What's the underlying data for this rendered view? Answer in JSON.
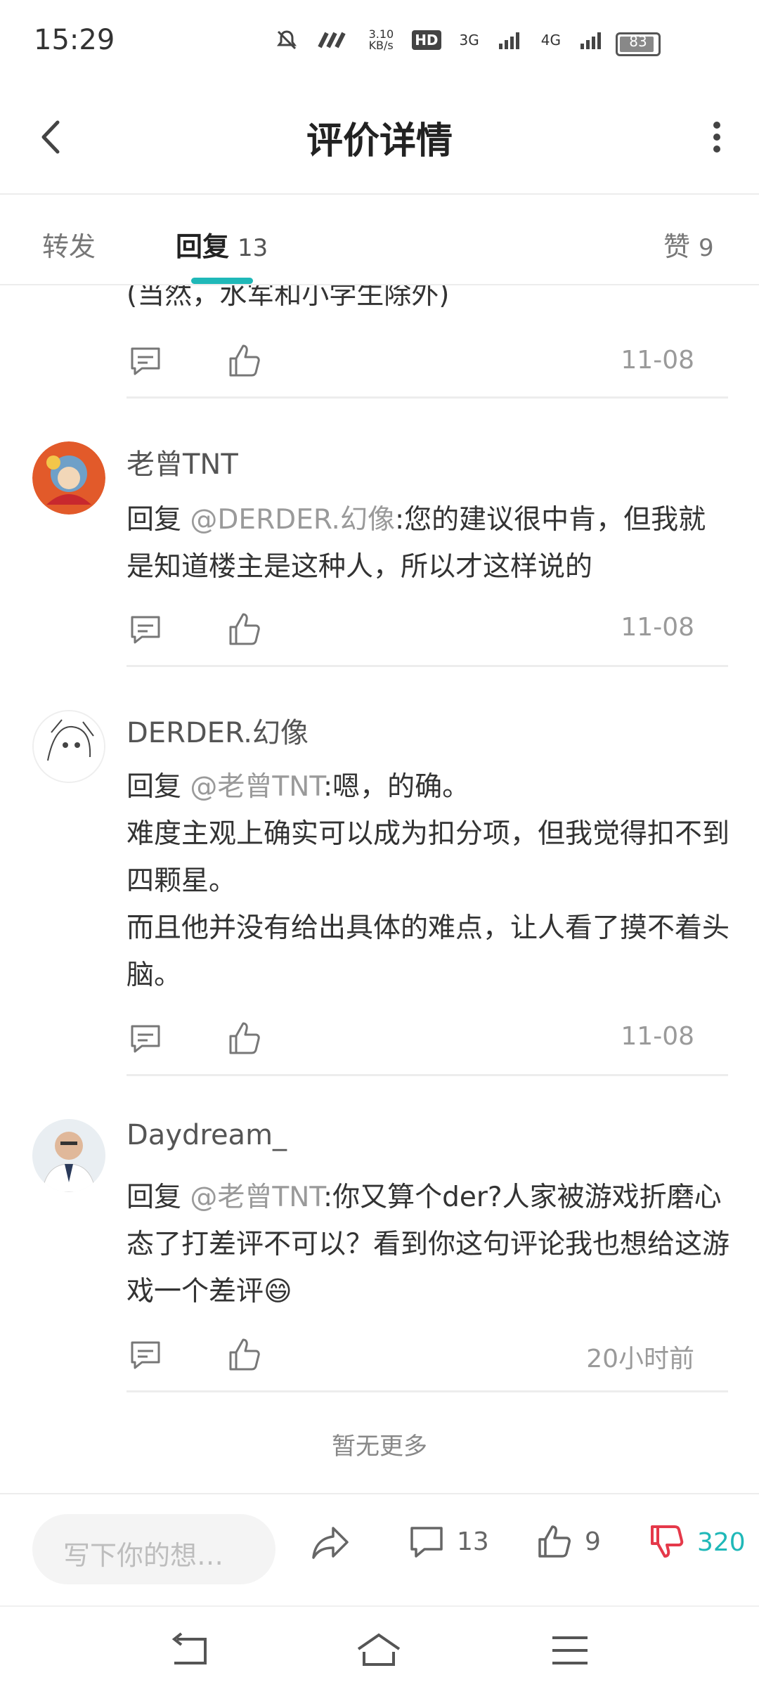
{
  "status": {
    "time": "15:29",
    "net_speed": "3.10\nKB/s",
    "hd": "HD",
    "sig1": "3G",
    "sig2": "4G",
    "battery": "83"
  },
  "header": {
    "title": "评价详情"
  },
  "tabs": [
    {
      "label": "转发"
    },
    {
      "label": "回复",
      "count": "13"
    },
    {
      "label": "赞",
      "count": "9"
    }
  ],
  "comments": [
    {
      "text": "(当然，水军和小学生除外)",
      "time": "11-08"
    },
    {
      "user": "老曾TNT",
      "prefix": " 回复 ",
      "mention": "@DERDER.幻像",
      "text": ":您的建议很中肯，但我就是知道楼主是这种人，所以才这样说的",
      "time": "11-08"
    },
    {
      "user": "DERDER.幻像",
      "prefix": " 回复 ",
      "mention": "@老曾TNT",
      "text": ":嗯，的确。\n难度主观上确实可以成为扣分项，但我觉得扣不到四颗星。\n而且他并没有给出具体的难点，让人看了摸不着头脑。",
      "time": "11-08"
    },
    {
      "user": "Daydream_",
      "prefix": " 回复 ",
      "mention": "@老曾TNT",
      "text": ":你又算个der?人家被游戏折磨心态了打差评不可以？看到你这句评论我也想给这游戏一个差评😄",
      "time": "20小时前"
    }
  ],
  "no_more": "暂无更多",
  "bottom_bar": {
    "placeholder": "写下你的想…",
    "comment_count": "13",
    "like_count": "9",
    "dislike_count": "320"
  }
}
